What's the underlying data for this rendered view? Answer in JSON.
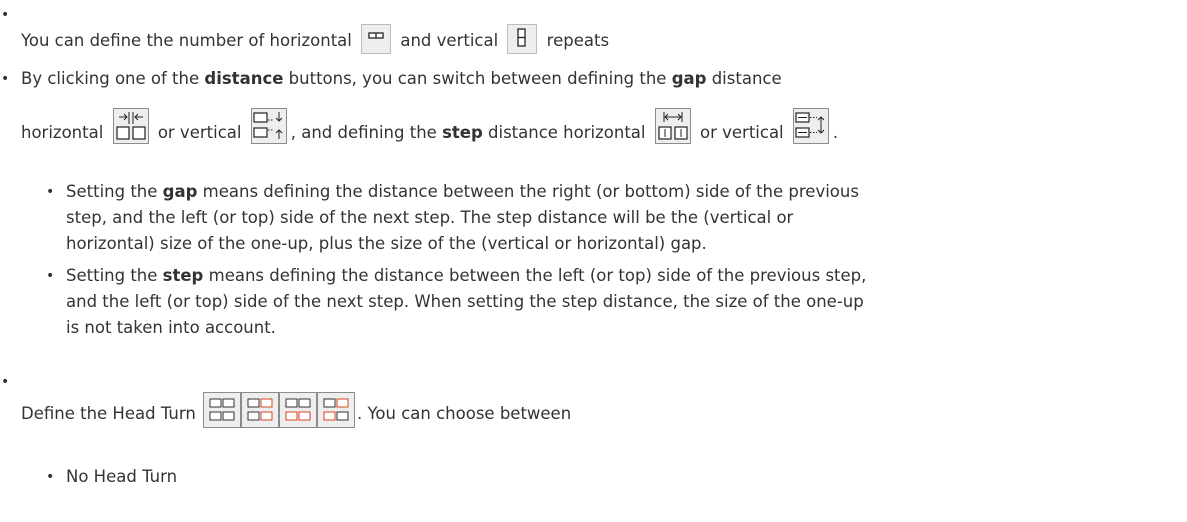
{
  "bullets": {
    "b1": {
      "text_before": "You can define the number of horizontal",
      "text_middle": "and vertical",
      "text_after": "repeats",
      "icon_horizontal": "horizontal-repeat-icon",
      "icon_vertical": "vertical-repeat-icon"
    },
    "b2": {
      "t1": "By clicking one of the ",
      "distance": "distance",
      "t2": " buttons, you can switch between defining the ",
      "gap": "gap",
      "t3": " distance",
      "t4": "horizontal",
      "t5": "or vertical",
      "t6": ", and defining the ",
      "step": "step",
      "t7": " distance horizontal",
      "t8": "or vertical",
      "t9": "."
    },
    "sub_gap": {
      "t1": "Setting the ",
      "gap": "gap",
      "t2": " means defining the distance between the right (or bottom) side of the previous",
      "l2": "step, and the left (or top) side of the next step. The step distance will be the (vertical or",
      "l3": "horizontal) size of the one-up, plus the size of the (vertical or horizontal) gap."
    },
    "sub_step": {
      "t1": "Setting the ",
      "step": "step",
      "t2": " means defining the distance between the left (or top) side of the previous step,",
      "l2": "and the left (or top) side of the next step. When setting the step distance, the size of the one-up",
      "l3": "is not taken into account."
    },
    "b3": {
      "t1": "Define the Head Turn",
      "t2": ". You can choose between"
    },
    "sub_head": {
      "t1": "No Head Turn"
    }
  },
  "colors": {
    "text": "#333333",
    "icon_border": "#8c8c8c",
    "icon_fill": "#eeeeee",
    "accent": "#d9411e"
  }
}
